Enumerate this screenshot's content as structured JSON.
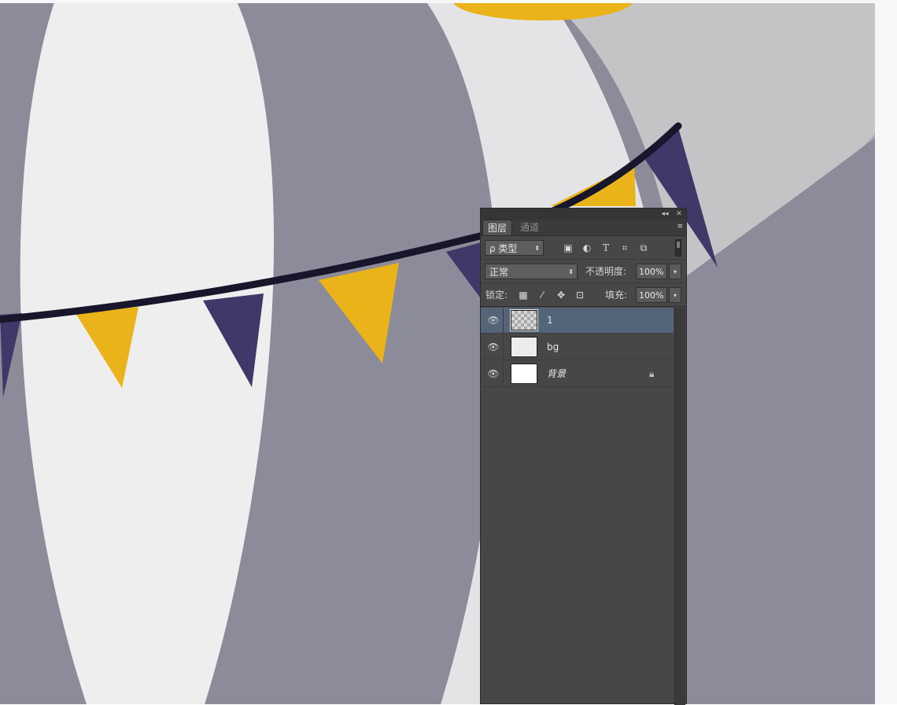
{
  "panel": {
    "title_controls": {
      "collapse": "◂◂",
      "close": "✕"
    },
    "tabs": [
      {
        "label": "图层",
        "active": true
      },
      {
        "label": "通道",
        "active": false
      }
    ],
    "menu_icon": "≡",
    "filter": {
      "kind_label": "ρ 类型",
      "icons": [
        "image-filter-icon",
        "adjustment-filter-icon",
        "type-filter-icon",
        "shape-filter-icon",
        "smart-object-filter-icon"
      ]
    },
    "blend_mode": "正常",
    "opacity_label": "不透明度:",
    "opacity_value": "100%",
    "lock_label": "锁定:",
    "lock_icons": [
      "lock-transparent-pixels-icon",
      "lock-image-pixels-icon",
      "lock-position-icon",
      "lock-all-icon"
    ],
    "fill_label": "填充:",
    "fill_value": "100%",
    "layers": [
      {
        "name": "1",
        "selected": true,
        "visible": true,
        "locked": false,
        "thumb": "checker"
      },
      {
        "name": "bg",
        "selected": false,
        "visible": true,
        "locked": false,
        "thumb": "light"
      },
      {
        "name": "背景",
        "selected": false,
        "visible": true,
        "locked": true,
        "thumb": "white"
      }
    ]
  },
  "colors": {
    "pennant_yellow": "#e9b319",
    "pennant_purple": "#3f3868",
    "string": "#17162b",
    "balloon_light": "#eeeeef",
    "balloon_grey": "#8c8b99",
    "background_light": "#c4c4c6",
    "background_grey": "#aeadb3",
    "panel_bg": "#474747",
    "selected_layer": "#556579"
  }
}
